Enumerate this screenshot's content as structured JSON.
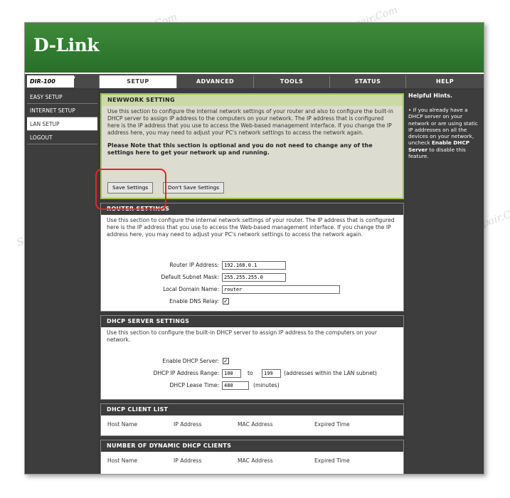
{
  "brand": {
    "logo": "D-Link",
    "model": "DIR-100"
  },
  "tabs": [
    {
      "label": "SETUP",
      "active": true
    },
    {
      "label": "ADVANCED",
      "active": false
    },
    {
      "label": "TOOLS",
      "active": false
    },
    {
      "label": "STATUS",
      "active": false
    },
    {
      "label": "HELP",
      "active": false
    }
  ],
  "sidebar": [
    {
      "label": "EASY SETUP",
      "active": false
    },
    {
      "label": "INTERNET SETUP",
      "active": false
    },
    {
      "label": "LAN SETUP",
      "active": true
    },
    {
      "label": "LOGOUT",
      "active": false
    }
  ],
  "network_setting": {
    "title": "NEWWORK SETTING",
    "desc": "Use this section to configure the internal network settings of your router and also to configure the built-in DHCP server to assign IP address to the computers on your network. The IP address that is configured here is the IP address that you use to access the Web-based management interface. If you change the IP address here, you may need to adjust your PC's network settings to access the network again.",
    "note": "Please Note that this section is optional and you do not need to change any of the settings here to get your network up and running.",
    "save_label": "Save Settings",
    "dont_save_label": "Don't Save Settings"
  },
  "router_settings": {
    "title": "ROUTER SETTINGS",
    "desc": "Use this section to configure the internal network settings of your router. The IP address that is configured here is the IP address that you use to access the Web-based management interface. If you change the IP address here, you may need to adjust your PC's network settings to access the network again.",
    "ip_label": "Router IP Address:",
    "ip_value": "192.168.0.1",
    "mask_label": "Default Subnet Mask:",
    "mask_value": "255.255.255.0",
    "domain_label": "Local Domain Name:",
    "domain_value": "router",
    "dns_label": "Enable DNS Relay:",
    "dns_checked": "✓"
  },
  "dhcp_server": {
    "title": "DHCP SERVER SETTINGS",
    "desc": "Use this section to configure the built-in DHCP server to assign IP address to the computers on your network.",
    "enable_label": "Enable DHCP Server:",
    "enable_checked": "✓",
    "range_label": "DHCP IP Address Range:",
    "range_start": "100",
    "range_to": "to",
    "range_end": "199",
    "range_note": "(addresses within the LAN subnet)",
    "lease_label": "DHCP Lease Time:",
    "lease_value": "480",
    "lease_unit": "(minutes)"
  },
  "dhcp_client_list": {
    "title": "DHCP CLIENT LIST",
    "columns": [
      "Host Name",
      "IP Address",
      "MAC Address",
      "Expired Time"
    ]
  },
  "dynamic_clients": {
    "title": "NUMBER OF DYNAMIC DHCP CLIENTS",
    "columns": [
      "Host Name",
      "IP Address",
      "MAC Address",
      "Expired Time"
    ]
  },
  "hints": {
    "title": "Helpful Hints.",
    "text_1": "• If you already have a DHCP server on your network or are using static IP addresses on all the devices on your network, uncheck ",
    "text_bold": "Enable DHCP Server",
    "text_2": " to disable this feature."
  },
  "watermark": "Soringpcrepair.Com",
  "colors": {
    "header_green": "#2f7a30",
    "accent_green": "#9ac34a",
    "highlight_red": "#e2262a",
    "dark_panel": "#3d3d3d"
  }
}
